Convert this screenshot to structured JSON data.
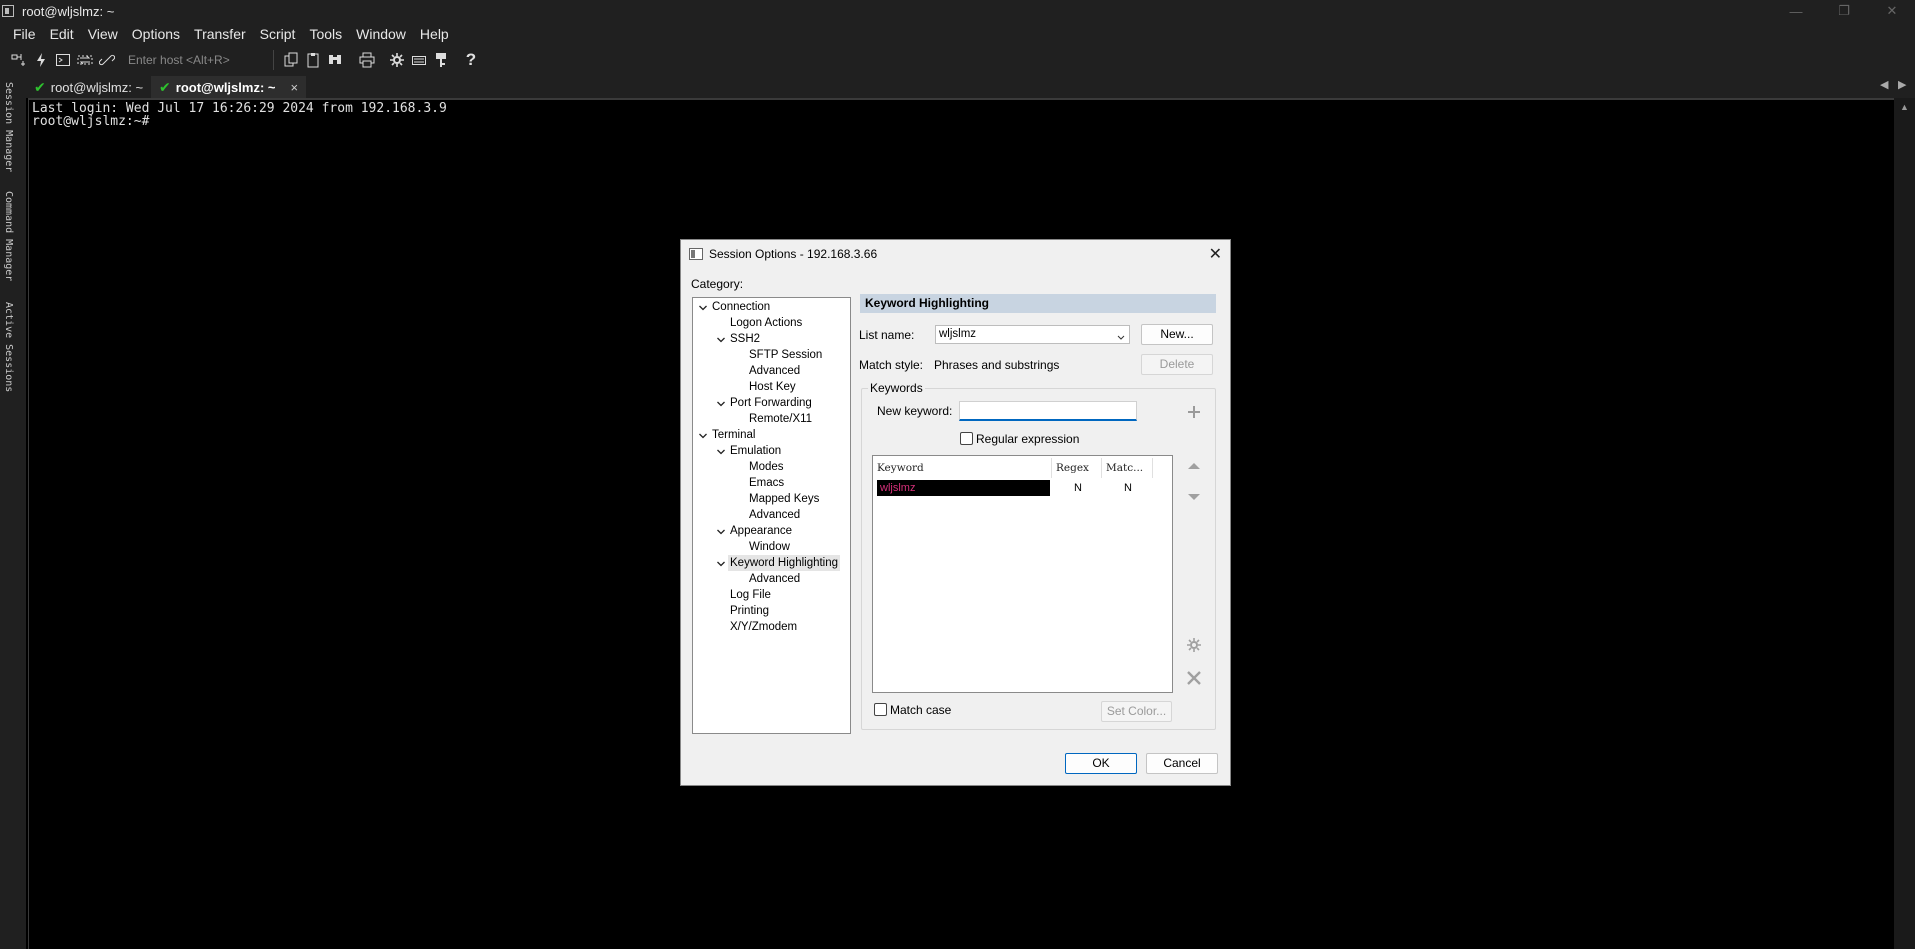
{
  "window": {
    "title": "root@wljslmz: ~",
    "controls": [
      "—",
      "❐",
      "✕"
    ]
  },
  "menu": [
    "File",
    "Edit",
    "View",
    "Options",
    "Transfer",
    "Script",
    "Tools",
    "Window",
    "Help"
  ],
  "toolbar": {
    "host_placeholder": "Enter host <Alt+R>",
    "help_icon": "?"
  },
  "tabs": [
    {
      "label": "root@wljslmz: ~",
      "active": false
    },
    {
      "label": "root@wljslmz: ~",
      "active": true,
      "close": "×"
    }
  ],
  "tab_nav": {
    "left": "◀",
    "right": "▶"
  },
  "side_panels": [
    "Session Manager",
    "Command Manager",
    "Active Sessions"
  ],
  "terminal": {
    "lines": [
      "Last login: Wed Jul 17 16:26:29 2024 from 192.168.3.9",
      "root@wljslmz:~#"
    ]
  },
  "dialog": {
    "title": "Session Options - 192.168.3.66",
    "close": "✕",
    "category_label": "Category:",
    "tree": [
      {
        "label": "Connection",
        "level": 0,
        "expanded": true
      },
      {
        "label": "Logon Actions",
        "level": 1
      },
      {
        "label": "SSH2",
        "level": 1,
        "expanded": true
      },
      {
        "label": "SFTP Session",
        "level": 2
      },
      {
        "label": "Advanced",
        "level": 2
      },
      {
        "label": "Host Key",
        "level": 2
      },
      {
        "label": "Port Forwarding",
        "level": 1,
        "expanded": true
      },
      {
        "label": "Remote/X11",
        "level": 2
      },
      {
        "label": "Terminal",
        "level": 0,
        "expanded": true
      },
      {
        "label": "Emulation",
        "level": 1,
        "expanded": true
      },
      {
        "label": "Modes",
        "level": 2
      },
      {
        "label": "Emacs",
        "level": 2
      },
      {
        "label": "Mapped Keys",
        "level": 2
      },
      {
        "label": "Advanced",
        "level": 2
      },
      {
        "label": "Appearance",
        "level": 1,
        "expanded": true
      },
      {
        "label": "Window",
        "level": 2
      },
      {
        "label": "Keyword Highlighting",
        "level": 1,
        "expanded": true,
        "selected": true
      },
      {
        "label": "Advanced",
        "level": 2
      },
      {
        "label": "Log File",
        "level": 1
      },
      {
        "label": "Printing",
        "level": 1
      },
      {
        "label": "X/Y/Zmodem",
        "level": 1
      }
    ],
    "section_title": "Keyword Highlighting",
    "list_name_label": "List name:",
    "list_name_value": "wljslmz",
    "new_button": "New...",
    "match_style_label": "Match style:",
    "match_style_value": "Phrases and substrings",
    "delete_button": "Delete",
    "keywords_group": "Keywords",
    "new_keyword_label": "New keyword:",
    "new_keyword_value": "",
    "regex_label": "Regular expression",
    "table": {
      "columns": [
        "Keyword",
        "Regex",
        "Matc..."
      ],
      "rows": [
        {
          "keyword": "wljslmz",
          "regex": "N",
          "match": "N"
        }
      ]
    },
    "match_case_label": "Match case",
    "set_color_button": "Set Color...",
    "ok_button": "OK",
    "cancel_button": "Cancel"
  },
  "colors": {
    "keyword_highlight": "#d6307a",
    "section_header_bg": "#c8d4e1",
    "accent": "#0067c0"
  }
}
